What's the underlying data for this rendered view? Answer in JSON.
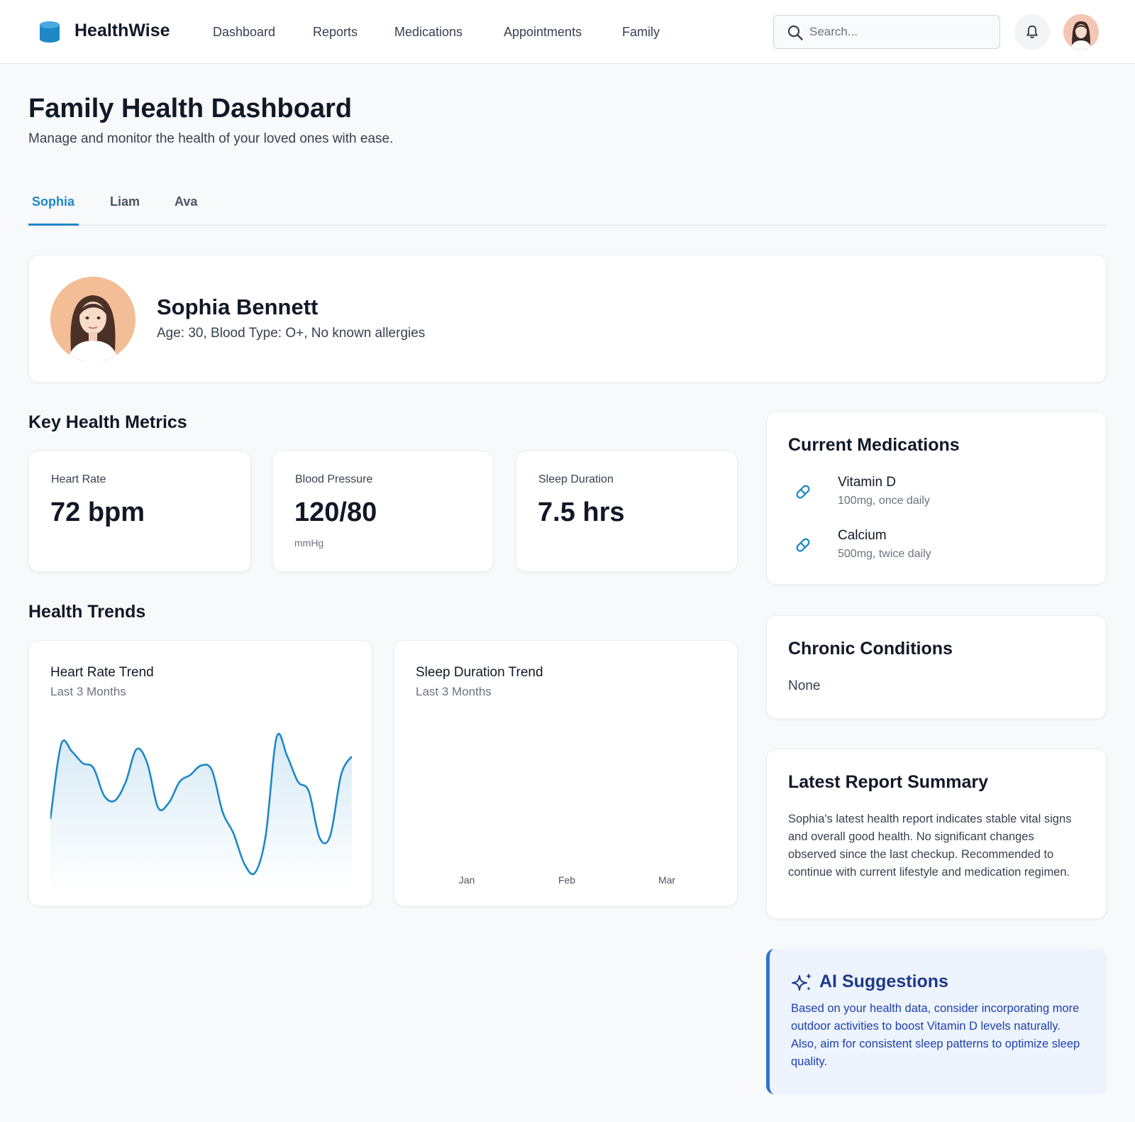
{
  "app": {
    "brand": "HealthWise"
  },
  "nav": {
    "items": [
      "Dashboard",
      "Reports",
      "Medications",
      "Appointments",
      "Family"
    ]
  },
  "search": {
    "placeholder": "Search..."
  },
  "page": {
    "title": "Family Health Dashboard",
    "subtitle": "Manage and monitor the health of your loved ones with ease."
  },
  "tabs": {
    "items": [
      "Sophia",
      "Liam",
      "Ava"
    ],
    "active": "Sophia"
  },
  "profile": {
    "name": "Sophia Bennett",
    "details": "Age: 30, Blood Type: O+, No known allergies"
  },
  "metrics": {
    "title": "Key Health Metrics",
    "items": [
      {
        "label": "Heart Rate",
        "value": "72 bpm",
        "unit": ""
      },
      {
        "label": "Blood Pressure",
        "value": "120/80",
        "unit": "mmHg"
      },
      {
        "label": "Sleep Duration",
        "value": "7.5 hrs",
        "unit": ""
      }
    ]
  },
  "trends": {
    "title": "Health Trends",
    "heart_rate": {
      "title": "Heart Rate Trend",
      "subtitle": "Last 3 Months"
    },
    "sleep": {
      "title": "Sleep Duration Trend",
      "subtitle": "Last 3 Months"
    }
  },
  "medications": {
    "title": "Current Medications",
    "items": [
      {
        "name": "Vitamin D",
        "dose": "100mg, once daily",
        "icon": "pill-icon"
      },
      {
        "name": "Calcium",
        "dose": "500mg, twice daily",
        "icon": "pill-icon"
      }
    ]
  },
  "conditions": {
    "title": "Chronic Conditions",
    "value": "None"
  },
  "report": {
    "title": "Latest Report Summary",
    "text": "Sophia's latest health report indicates stable vital signs and overall good health. No significant changes observed since the last checkup. Recommended to continue with current lifestyle and medication regimen."
  },
  "ai": {
    "title": "AI Suggestions",
    "text": "Based on your health data, consider incorporating more outdoor activities to boost Vitamin D levels naturally. Also, aim for consistent sleep patterns to optimize sleep quality."
  },
  "colors": {
    "accent": "#1e88c7",
    "ai_background": "#eef4fd",
    "ai_border": "#2f74d0",
    "ai_text": "#1e3a8a"
  },
  "chart_data": [
    {
      "type": "area",
      "title": "Heart Rate Trend",
      "subtitle": "Last 3 Months",
      "values": [
        52,
        84,
        81,
        76,
        74,
        62,
        60,
        68,
        82,
        76,
        57,
        59,
        68,
        71,
        75,
        73,
        55,
        46,
        33,
        29,
        45,
        87,
        79,
        68,
        64,
        44,
        45,
        71,
        79
      ],
      "ylim": [
        25,
        95
      ],
      "grid": false,
      "legend": "none"
    },
    {
      "type": "line",
      "title": "Sleep Duration Trend",
      "subtitle": "Last 3 Months",
      "categories": [
        "Jan",
        "Feb",
        "Mar"
      ],
      "values": [],
      "grid": false,
      "legend": "none"
    }
  ]
}
